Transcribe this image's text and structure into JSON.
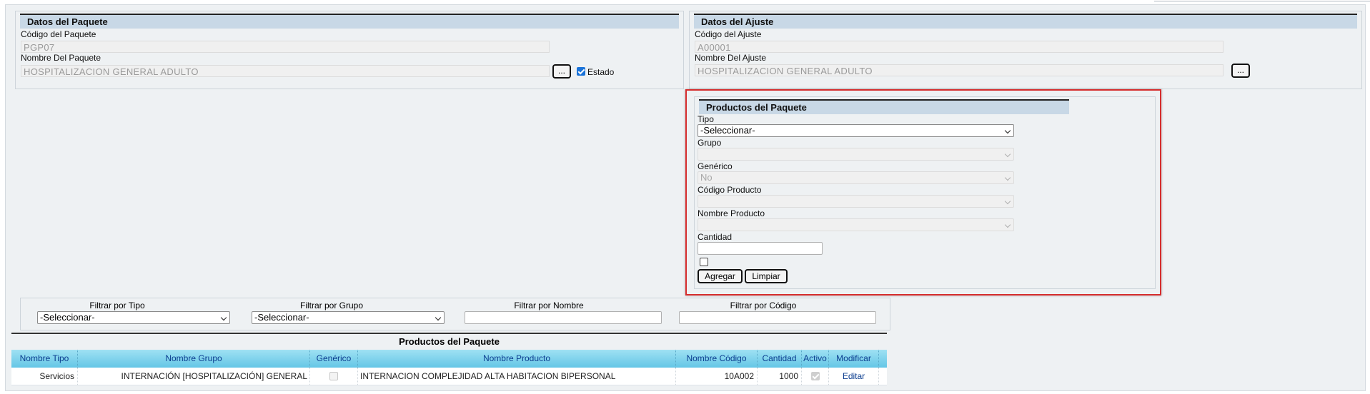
{
  "paquete": {
    "title": "Datos del Paquete",
    "codigo_label": "Código del Paquete",
    "codigo_value": "PGP07",
    "nombre_label": "Nombre Del Paquete",
    "nombre_value": "HOSPITALIZACION GENERAL ADULTO",
    "lookup_button": "...",
    "estado_label": "Estado",
    "estado_checked": true
  },
  "ajuste": {
    "title": "Datos del Ajuste",
    "codigo_label": "Código del Ajuste",
    "codigo_value": "A00001",
    "nombre_label": "Nombre Del Ajuste",
    "nombre_value": "HOSPITALIZACION GENERAL ADULTO",
    "lookup_button": "..."
  },
  "productos_form": {
    "title": "Productos del Paquete",
    "tipo_label": "Tipo",
    "tipo_value": "-Seleccionar-",
    "grupo_label": "Grupo",
    "grupo_value": "",
    "generico_label": "Genérico",
    "generico_value": "No",
    "codigo_label": "Código Producto",
    "codigo_value": "",
    "nombre_label": "Nombre Producto",
    "nombre_value": "",
    "cantidad_label": "Cantidad",
    "cantidad_value": "",
    "agregar_button": "Agregar",
    "limpiar_button": "Limpiar"
  },
  "filters": {
    "tipo_label": "Filtrar por Tipo",
    "tipo_value": "-Seleccionar-",
    "grupo_label": "Filtrar por Grupo",
    "grupo_value": "-Seleccionar-",
    "nombre_label": "Filtrar por Nombre",
    "codigo_label": "Filtrar por Código"
  },
  "grid": {
    "caption": "Productos del Paquete",
    "columns": [
      "Nombre Tipo",
      "Nombre Grupo",
      "Genérico",
      "Nombre Producto",
      "Nombre Código",
      "Cantidad",
      "Activo",
      "Modificar"
    ],
    "rows": [
      {
        "tipo": "Servicios",
        "grupo": "INTERNACIÓN [HOSPITALIZACIÓN] GENERAL",
        "generico": false,
        "producto": "INTERNACION COMPLEJIDAD ALTA HABITACION BIPERSONAL",
        "codigo": "10A002",
        "cantidad": "1000",
        "activo": true,
        "modificar": "Editar"
      }
    ]
  },
  "colors": {
    "panel_bg": "#eef1f3",
    "title_bg": "#c8d8e6",
    "grid_header": "#64c6e6",
    "highlight_border": "#d62d2d",
    "link": "#0b3d8f"
  }
}
